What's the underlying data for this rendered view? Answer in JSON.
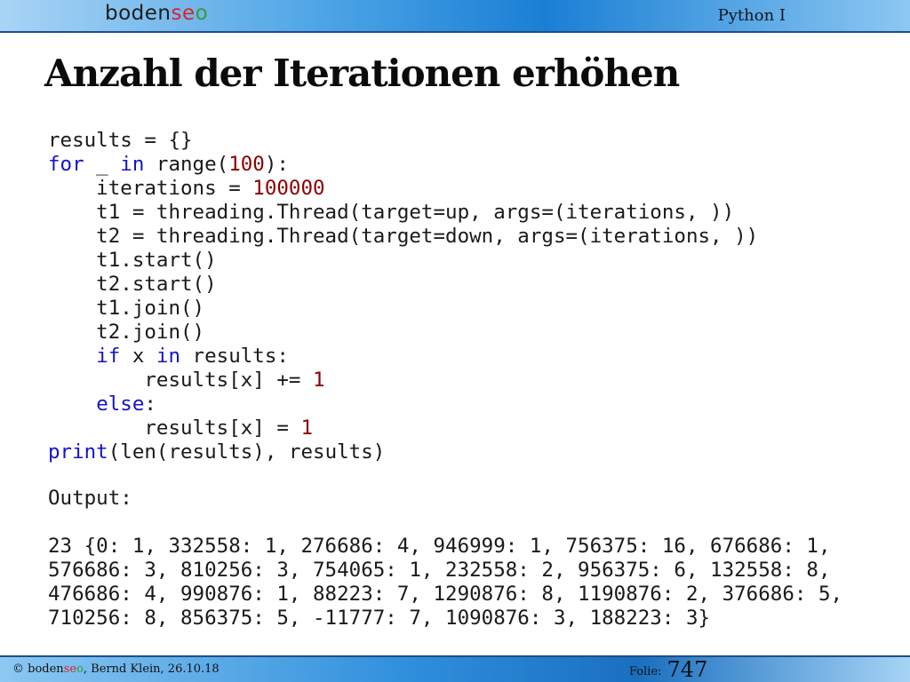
{
  "header": {
    "logo": {
      "part1": "boden",
      "part2": "se",
      "part3": "o"
    },
    "course": "Python I"
  },
  "slide": {
    "title": "Anzahl der Iterationen erhöhen"
  },
  "code_lines": [
    [
      {
        "t": "results = {}"
      }
    ],
    [
      {
        "t": "for",
        "c": "kw"
      },
      {
        "t": " _ "
      },
      {
        "t": "in",
        "c": "kw"
      },
      {
        "t": " range("
      },
      {
        "t": "100",
        "c": "num"
      },
      {
        "t": "):"
      }
    ],
    [
      {
        "t": "    iterations = "
      },
      {
        "t": "100000",
        "c": "num"
      }
    ],
    [
      {
        "t": "    t1 = threading.Thread(target=up, args=(iterations, ))"
      }
    ],
    [
      {
        "t": "    t2 = threading.Thread(target=down, args=(iterations, ))"
      }
    ],
    [
      {
        "t": "    t1.start()"
      }
    ],
    [
      {
        "t": "    t2.start()"
      }
    ],
    [
      {
        "t": "    t1.join()"
      }
    ],
    [
      {
        "t": "    t2.join()"
      }
    ],
    [
      {
        "t": "    "
      },
      {
        "t": "if",
        "c": "kw"
      },
      {
        "t": " x "
      },
      {
        "t": "in",
        "c": "kw"
      },
      {
        "t": " results:"
      }
    ],
    [
      {
        "t": "        results[x] += "
      },
      {
        "t": "1",
        "c": "num"
      }
    ],
    [
      {
        "t": "    "
      },
      {
        "t": "else",
        "c": "kw"
      },
      {
        "t": ":"
      }
    ],
    [
      {
        "t": "        results[x] = "
      },
      {
        "t": "1",
        "c": "num"
      }
    ],
    [
      {
        "t": "print",
        "c": "kw"
      },
      {
        "t": "(len(results), results)"
      }
    ]
  ],
  "output": {
    "label": "Output:",
    "lines": [
      "23 {0: 1, 332558: 1, 276686: 4, 946999: 1, 756375: 16, 676686: 1,",
      "576686: 3, 810256: 3, 754065: 1, 232558: 2, 956375: 6, 132558: 8,",
      "476686: 4, 990876: 1, 88223: 7, 1290876: 8, 1190876: 2, 376686: 5,",
      "710256: 8, 856375: 5, -11777: 7, 1090876: 3, 188223: 3}"
    ]
  },
  "footer": {
    "copyright": "© ",
    "brand": {
      "part1": "boden",
      "part2": "se",
      "part3": "o"
    },
    "author_date": ", Bernd Klein, 26.10.18",
    "folie_label": "Folie:",
    "folie_number": "747"
  },
  "colors": {
    "keyword": "#1414c8",
    "number": "#8b0000",
    "brand_red": "#d9232e",
    "brand_green": "#3a9b3a"
  }
}
